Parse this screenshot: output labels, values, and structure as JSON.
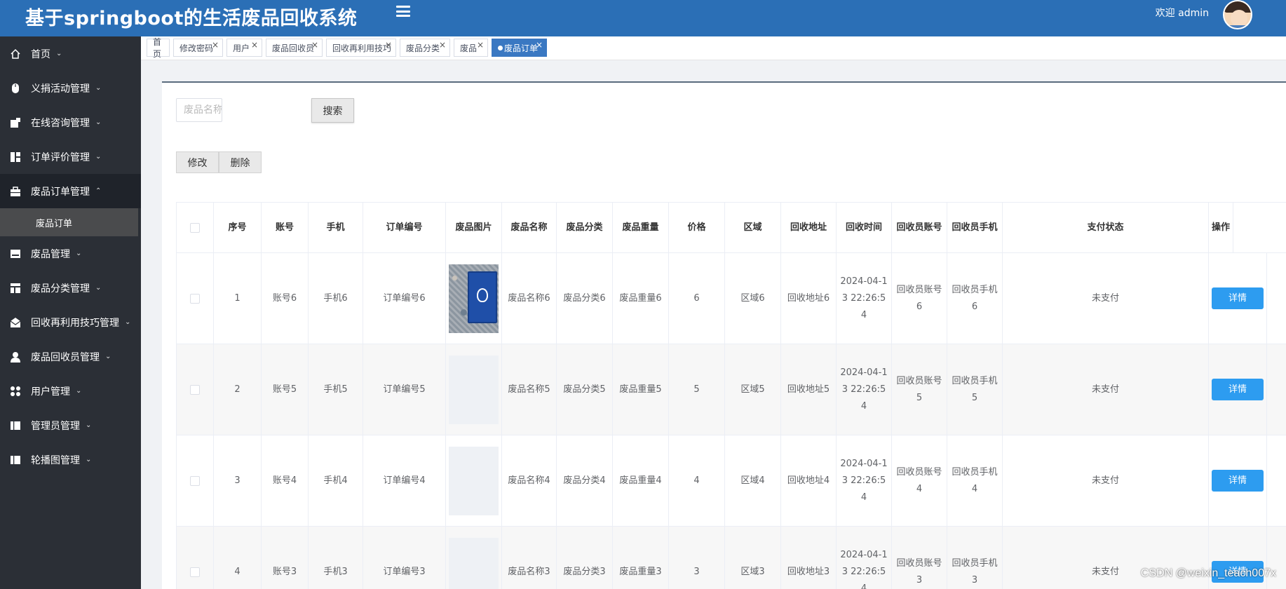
{
  "header": {
    "title": "基于springboot的生活废品回收系统",
    "welcome": "欢迎 admin"
  },
  "sidebar": {
    "items": [
      {
        "label": "首页",
        "icon": "home-icon",
        "chevron": "⌄"
      },
      {
        "label": "义捐活动管理",
        "icon": "mouse-icon",
        "chevron": "⌄"
      },
      {
        "label": "在线咨询管理",
        "icon": "chat-icon",
        "chevron": "⌄"
      },
      {
        "label": "订单评价管理",
        "icon": "grid-icon",
        "chevron": "⌄"
      },
      {
        "label": "废品订单管理",
        "icon": "briefcase-icon",
        "chevron": "⌃"
      },
      {
        "label": "废品管理",
        "icon": "inbox-icon",
        "chevron": "⌄"
      },
      {
        "label": "废品分类管理",
        "icon": "layout-icon",
        "chevron": "⌄"
      },
      {
        "label": "回收再利用技巧管理",
        "icon": "mail-open-icon",
        "chevron": "⌄"
      },
      {
        "label": "废品回收员管理",
        "icon": "user-icon",
        "chevron": "⌄"
      },
      {
        "label": "用户管理",
        "icon": "apps-icon",
        "chevron": "⌄"
      },
      {
        "label": "管理员管理",
        "icon": "columns-icon",
        "chevron": "⌄"
      },
      {
        "label": "轮播图管理",
        "icon": "columns-icon",
        "chevron": "⌄"
      }
    ],
    "sub_item": "废品订单"
  },
  "tabs": [
    {
      "label": "首页",
      "closable": false
    },
    {
      "label": "修改密码",
      "closable": true
    },
    {
      "label": "用户",
      "closable": true
    },
    {
      "label": "废品回收员",
      "closable": true
    },
    {
      "label": "回收再利用技巧",
      "closable": true
    },
    {
      "label": "废品分类",
      "closable": true
    },
    {
      "label": "废品",
      "closable": true
    },
    {
      "label": "废品订单",
      "closable": true,
      "active": true
    }
  ],
  "tab_close": "×",
  "search": {
    "placeholder": "废品名称",
    "button": "搜索"
  },
  "actions": {
    "edit": "修改",
    "delete": "删除"
  },
  "table": {
    "columns": [
      "序号",
      "账号",
      "手机",
      "订单编号",
      "废品图片",
      "废品名称",
      "废品分类",
      "废品重量",
      "价格",
      "区域",
      "回收地址",
      "回收时间",
      "回收员账号",
      "回收员手机",
      "支付状态",
      "操作"
    ],
    "rows": [
      {
        "index": "1",
        "account": "账号6",
        "phone": "手机6",
        "order_no": "订单编号6",
        "image": "photo",
        "name": "废品名称6",
        "category": "废品分类6",
        "weight": "废品重量6",
        "price": "6",
        "area": "区域6",
        "address": "回收地址6",
        "time": "2024-04-13 22:26:54",
        "collector_account": "回收员账号6",
        "collector_phone": "回收员手机6",
        "pay_status": "未支付",
        "action": "详情"
      },
      {
        "index": "2",
        "account": "账号5",
        "phone": "手机5",
        "order_no": "订单编号5",
        "image": "blank",
        "name": "废品名称5",
        "category": "废品分类5",
        "weight": "废品重量5",
        "price": "5",
        "area": "区域5",
        "address": "回收地址5",
        "time": "2024-04-13 22:26:54",
        "collector_account": "回收员账号5",
        "collector_phone": "回收员手机5",
        "pay_status": "未支付",
        "action": "详情"
      },
      {
        "index": "3",
        "account": "账号4",
        "phone": "手机4",
        "order_no": "订单编号4",
        "image": "blank",
        "name": "废品名称4",
        "category": "废品分类4",
        "weight": "废品重量4",
        "price": "4",
        "area": "区域4",
        "address": "回收地址4",
        "time": "2024-04-13 22:26:54",
        "collector_account": "回收员账号4",
        "collector_phone": "回收员手机4",
        "pay_status": "未支付",
        "action": "详情"
      },
      {
        "index": "4",
        "account": "账号3",
        "phone": "手机3",
        "order_no": "订单编号3",
        "image": "blank",
        "name": "废品名称3",
        "category": "废品分类3",
        "weight": "废品重量3",
        "price": "3",
        "area": "区域3",
        "address": "回收地址3",
        "time": "2024-04-13 22:26:54",
        "collector_account": "回收员账号3",
        "collector_phone": "回收员手机3",
        "pay_status": "未支付",
        "action": "详情"
      }
    ]
  },
  "watermark": "CSDN @weixin_teach007x",
  "colors": {
    "header_bg": "#2b6fb6",
    "sidebar_bg": "#2b2f36",
    "active_tab": "#3a78c2",
    "detail_button": "#2d9cf0"
  }
}
